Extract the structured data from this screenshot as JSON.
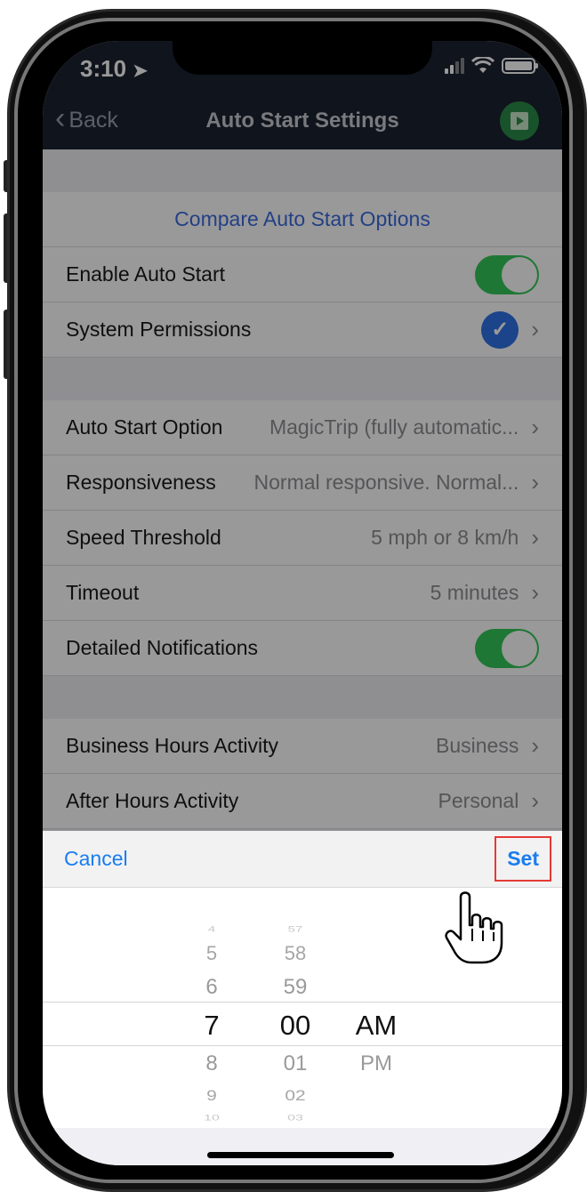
{
  "status": {
    "time": "3:10"
  },
  "nav": {
    "back_label": "Back",
    "title": "Auto Start Settings"
  },
  "compare_link": "Compare Auto Start Options",
  "permissions": {
    "enable_auto_start": {
      "label": "Enable Auto Start",
      "on": true
    },
    "system_permissions": {
      "label": "System Permissions"
    }
  },
  "options": [
    {
      "label": "Auto Start Option",
      "value": "MagicTrip (fully automatic..."
    },
    {
      "label": "Responsiveness",
      "value": "Normal responsive. Normal..."
    },
    {
      "label": "Speed Threshold",
      "value": "5 mph or 8 km/h"
    },
    {
      "label": "Timeout",
      "value": "5 minutes"
    }
  ],
  "detailed_notifications": {
    "label": "Detailed Notifications",
    "on": true
  },
  "activity": [
    {
      "label": "Business Hours Activity",
      "value": "Business"
    },
    {
      "label": "After Hours Activity",
      "value": "Personal"
    }
  ],
  "picker_toolbar": {
    "cancel_label": "Cancel",
    "set_label": "Set"
  },
  "time_picker": {
    "hours": [
      "4",
      "5",
      "6",
      "7",
      "8",
      "9",
      "10"
    ],
    "minutes": [
      "57",
      "58",
      "59",
      "00",
      "01",
      "02",
      "03"
    ],
    "period": [
      "AM",
      "PM"
    ],
    "selected": {
      "hour": "7",
      "minute": "00",
      "period": "AM"
    }
  },
  "colors": {
    "accent": "#1a7cf0",
    "toggle_on": "#34c759",
    "nav_bg": "#1c2230"
  }
}
